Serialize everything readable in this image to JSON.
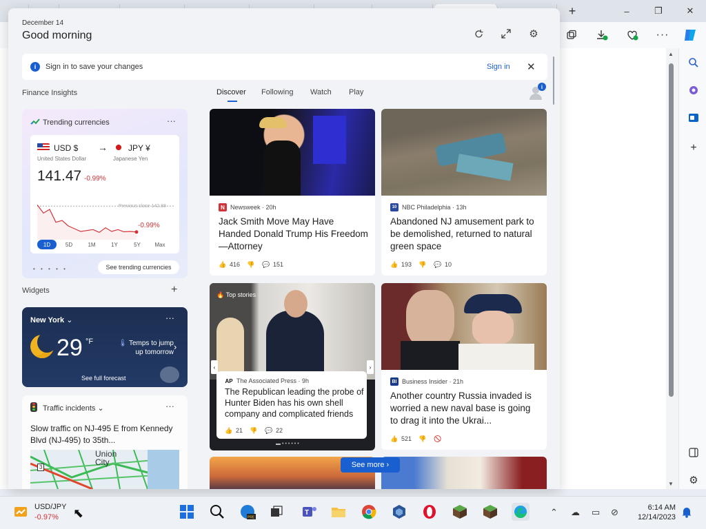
{
  "browser": {
    "tabs": [
      "",
      "",
      "",
      "",
      "",
      "",
      "",
      "",
      ""
    ],
    "tab_icons": [
      "edge-favicon",
      "widgets-favicon",
      "page-favicon",
      "page-favicon",
      "page-favicon",
      "page-favicon",
      "page-favicon",
      "page-favicon",
      "page-favicon"
    ],
    "new_tab_label": "+",
    "window_controls": [
      "minimize",
      "restore",
      "close"
    ],
    "toolbar_icons": [
      "collections-icon",
      "downloads-icon",
      "performance-icon",
      "more-icon",
      "copilot-icon"
    ],
    "sidebar_icons": [
      "search-icon",
      "extensions-icon",
      "outlook-icon",
      "add-icon",
      "split-icon",
      "settings-icon"
    ]
  },
  "panel": {
    "date": "December 14",
    "greeting": "Good morning",
    "header_icons": [
      "refresh-icon",
      "expand-icon",
      "settings-icon"
    ],
    "signin_bar": {
      "message": "Sign in to save your changes",
      "link": "Sign in",
      "info_glyph": "i"
    }
  },
  "finance": {
    "section_title": "Finance Insights",
    "card_title": "Trending currencies",
    "more": "···",
    "from_code": "USD $",
    "from_name": "United States Dollar",
    "to_code": "JPY ¥",
    "to_name": "Japanese Yen",
    "arrow": "→",
    "rate": "141.47",
    "change": "-0.99%",
    "previous_close_label": "Previous close 142.88",
    "chart_change": "-0.99%",
    "ranges": [
      "1D",
      "5D",
      "1M",
      "1Y",
      "5Y",
      "Max"
    ],
    "selected_range": "1D",
    "see_trending": "See trending currencies",
    "pager": "• • • • •",
    "colors": {
      "down": "#d13438",
      "accent": "#1a5fd0"
    },
    "chart_data": {
      "type": "line",
      "title": "",
      "xlabel": "",
      "ylabel": "",
      "previous_close": 142.88,
      "values": [
        142.95,
        142.5,
        142.7,
        142.0,
        142.1,
        141.8,
        141.65,
        141.5,
        141.55,
        141.6,
        141.45,
        141.7,
        141.5,
        141.6,
        141.48,
        141.5,
        141.47
      ]
    }
  },
  "widgets": {
    "section_title": "Widgets",
    "add": "+",
    "weather": {
      "location": "New York",
      "temp": "29",
      "unit": "°F",
      "note": "Temps to jump up tomorrow",
      "forecast_link": "See full forecast",
      "more": "···"
    },
    "traffic": {
      "title": "Traffic incidents",
      "more": "···",
      "description": "Slow traffic on NJ-495 E from Kennedy Blvd (NJ-495) to 35th...",
      "map_label": "Union City",
      "map_route": "3"
    }
  },
  "feed": {
    "tabs": [
      "Discover",
      "Following",
      "Watch",
      "Play"
    ],
    "selected_tab": "Discover",
    "avatar_badge": "i",
    "see_more": "See more",
    "cards": [
      {
        "source": "Newsweek · 20h",
        "logo": "N",
        "logo_color": "#d13438",
        "headline": "Jack Smith Move May Have Handed Donald Trump His Freedom—Attorney",
        "likes": "416",
        "comments": "151"
      },
      {
        "source": "NBC Philadelphia · 13h",
        "logo": "10",
        "logo_color": "#2a4aa0",
        "headline": "Abandoned NJ amusement park to be demolished, returned to natural green space",
        "likes": "193",
        "comments": "10"
      },
      {
        "source": "The Associated Press · 9h",
        "logo": "AP",
        "logo_color": "#222222",
        "label": "Top stories",
        "headline": "The Republican leading the probe of Hunter Biden has his own shell company and complicated friends",
        "likes": "21",
        "comments": "22"
      },
      {
        "source": "Business Insider · 21h",
        "logo": "BI",
        "logo_color": "#1a3a8a",
        "headline": "Another country Russia invaded is worried a new naval base is going to drag it into the Ukrai...",
        "likes": "521",
        "comments": ""
      }
    ]
  },
  "taskbar": {
    "ticker_symbol": "USD/JPY",
    "ticker_change": "-0.97%",
    "apps": [
      "start",
      "search",
      "edge-beta",
      "task-view",
      "teams",
      "file-explorer",
      "chrome",
      "virtualbox",
      "opera",
      "minecraft",
      "minecraft-2",
      "edge"
    ],
    "time": "6:14 AM",
    "date": "12/14/2023"
  }
}
